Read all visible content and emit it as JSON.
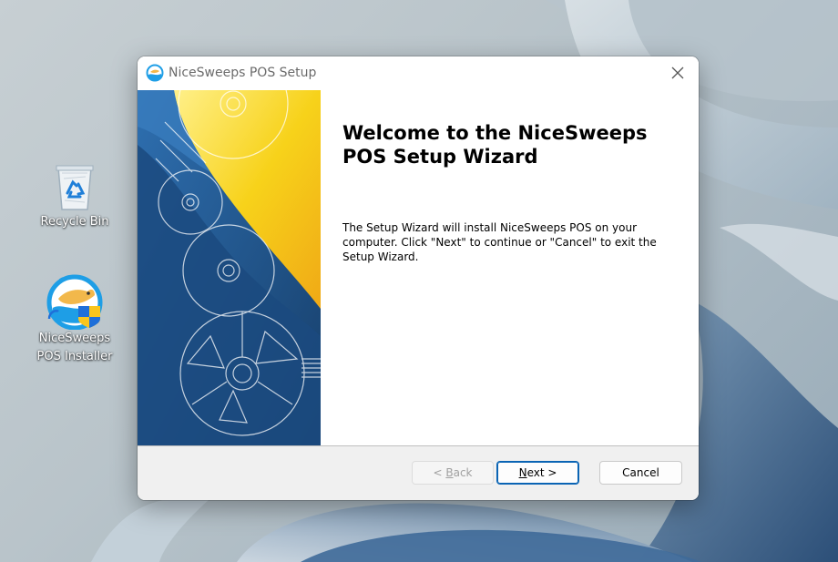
{
  "desktop": {
    "icons": [
      {
        "label_line1": "Recycle Bin",
        "label_line2": ""
      },
      {
        "label_line1": "NiceSweeps",
        "label_line2": "POS Installer"
      }
    ]
  },
  "dialog": {
    "title": "NiceSweeps POS Setup",
    "heading": "Welcome to the NiceSweeps POS Setup Wizard",
    "body": "The Setup Wizard will install NiceSweeps POS on your computer.  Click \"Next\" to continue or \"Cancel\" to exit the Setup Wizard.",
    "buttons": {
      "back_prefix": "< ",
      "back_accel": "B",
      "back_rest": "ack",
      "next_accel": "N",
      "next_rest": "ext >",
      "cancel": "Cancel"
    }
  },
  "colors": {
    "banner_blue": "#1c4f86",
    "banner_yellow": "#f7d21a",
    "default_button_border": "#0a64b4"
  },
  "icons": [
    "recycle-bin-icon",
    "installer-icon",
    "app-icon",
    "close-icon"
  ]
}
